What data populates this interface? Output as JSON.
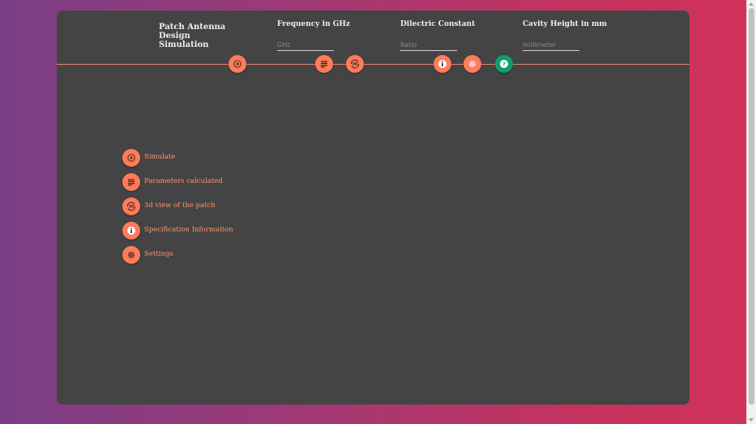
{
  "app": {
    "title": "Patch Antenna Design Simulation"
  },
  "inputs": {
    "frequency": {
      "label": "Frequency in GHz",
      "placeholder": "GHz",
      "value": ""
    },
    "dielectric": {
      "label": "Dilectric Constant",
      "placeholder": "Ratio",
      "value": ""
    },
    "cavity": {
      "label": "Cavity Height in mm",
      "placeholder": "millimeter",
      "value": ""
    }
  },
  "toolbar": {
    "simulate_icon": "play-icon",
    "parameters_icon": "list-icon",
    "view3d_icon": "rotate-3d-icon",
    "spec_icon": "info-icon",
    "settings_icon": "gear-icon",
    "help_icon": "help-icon"
  },
  "legend": [
    {
      "icon": "play-icon",
      "label": "Simulate"
    },
    {
      "icon": "list-icon",
      "label": "Parameters calculated"
    },
    {
      "icon": "rotate-3d-icon",
      "label": "3d view of the patch"
    },
    {
      "icon": "info-icon",
      "label": "Specification Information"
    },
    {
      "icon": "gear-icon",
      "label": "Settings"
    }
  ],
  "colors": {
    "accent": "#ff7b5a",
    "help": "#0e9f6e",
    "panel": "#444444",
    "legend_text": "#ff9470"
  }
}
